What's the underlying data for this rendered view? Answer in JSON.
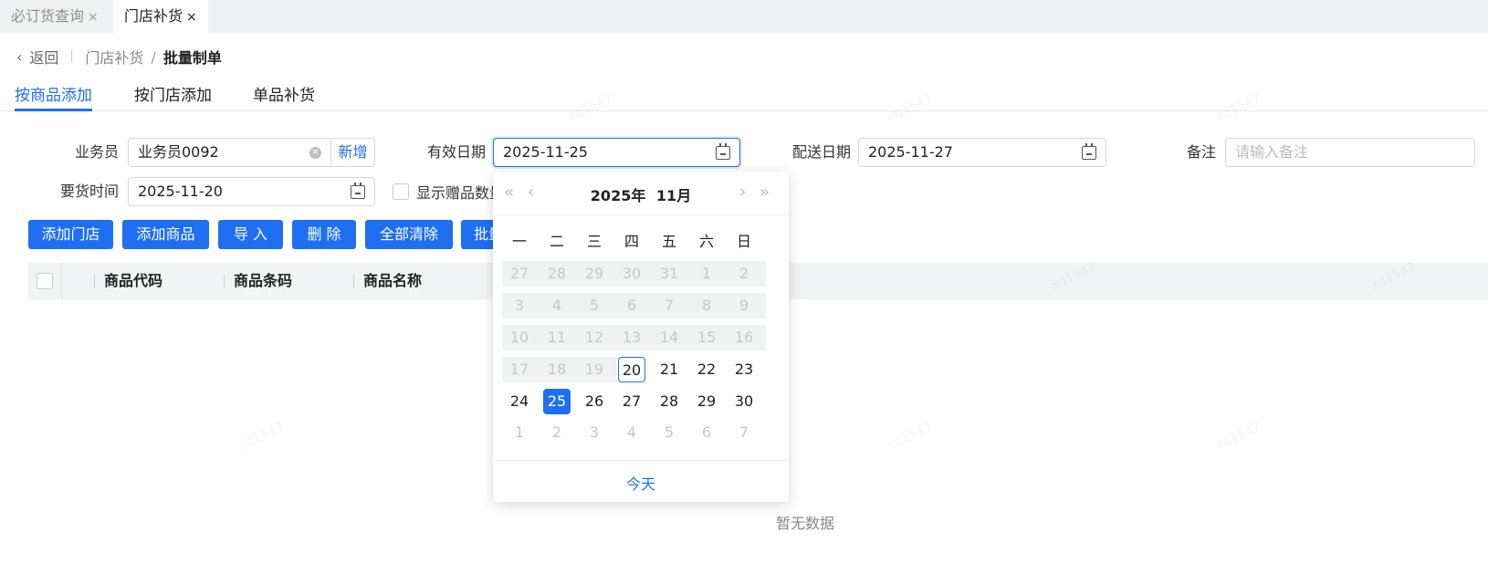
{
  "tabs": [
    {
      "label": "必订货查询",
      "close": "×"
    },
    {
      "label": "门店补货",
      "close": "×"
    }
  ],
  "breadcrumb": {
    "back": "返回",
    "parent": "门店补货",
    "separator": "/",
    "current": "批量制单"
  },
  "subtabs": [
    "按商品添加",
    "按门店添加",
    "单品补货"
  ],
  "form": {
    "salesman_label": "业务员",
    "salesman_value": "业务员0092",
    "add_new": "新增",
    "valid_date_label": "有效日期",
    "valid_date_value": "2025-11-25",
    "delivery_date_label": "配送日期",
    "delivery_date_value": "2025-11-27",
    "remark_label": "备注",
    "remark_placeholder": "请输入备注",
    "request_time_label": "要货时间",
    "request_time_value": "2025-11-20",
    "show_gift_label": "显示赠品数量"
  },
  "buttons": [
    "添加门店",
    "添加商品",
    "导 入",
    "删 除",
    "全部清除",
    "批量"
  ],
  "table": {
    "columns": [
      "商品代码",
      "商品条码",
      "商品名称"
    ],
    "empty_text": "暂无数据"
  },
  "datepicker": {
    "year": "2025年",
    "month": "11月",
    "prev_year": "«",
    "prev_month": "‹",
    "next_month": "›",
    "next_year": "»",
    "weekdays": [
      "一",
      "二",
      "三",
      "四",
      "五",
      "六",
      "日"
    ],
    "weeks": [
      [
        "27",
        "28",
        "29",
        "30",
        "31",
        "1",
        "2"
      ],
      [
        "3",
        "4",
        "5",
        "6",
        "7",
        "8",
        "9"
      ],
      [
        "10",
        "11",
        "12",
        "13",
        "14",
        "15",
        "16"
      ],
      [
        "17",
        "18",
        "19",
        "20",
        "21",
        "22",
        "23"
      ],
      [
        "24",
        "25",
        "26",
        "27",
        "28",
        "29",
        "30"
      ],
      [
        "1",
        "2",
        "3",
        "4",
        "5",
        "6",
        "7"
      ]
    ],
    "today_day": "20",
    "selected_day": "25",
    "today_button": "今天"
  },
  "watermark": "xq1547",
  "colors": {
    "primary": "#1f6ff2",
    "header_bg": "#f2f3f5",
    "tabstrip_bg": "#f0f1f3"
  }
}
